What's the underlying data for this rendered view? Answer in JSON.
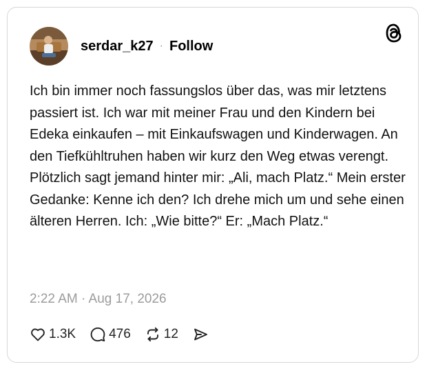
{
  "post": {
    "username": "serdar_k27",
    "separator": "·",
    "follow_label": "Follow",
    "text": "Ich bin immer noch fassungslos über das, was mir letztens passiert ist. Ich war mit meiner Frau und den Kindern bei Edeka einkaufen – mit Einkaufswagen und Kinderwagen. An den Tiefkühltruhen haben wir kurz den Weg etwas verengt. Plötzlich sagt jemand hinter mir: „Ali, mach Platz.“ Mein erster Gedanke: Kenne ich den? Ich drehe mich um und sehe einen älteren Herren. Ich: „Wie bitte?“ Er: „Mach Platz.“",
    "timestamp": "2:22 AM · Aug 17, 2026"
  },
  "actions": {
    "likes": "1.3K",
    "replies": "476",
    "reposts": "12"
  },
  "icons": {
    "brand": "threads-logo-icon",
    "like": "heart-icon",
    "reply": "speech-bubble-icon",
    "repost": "repost-arrows-icon",
    "share": "send-icon"
  }
}
